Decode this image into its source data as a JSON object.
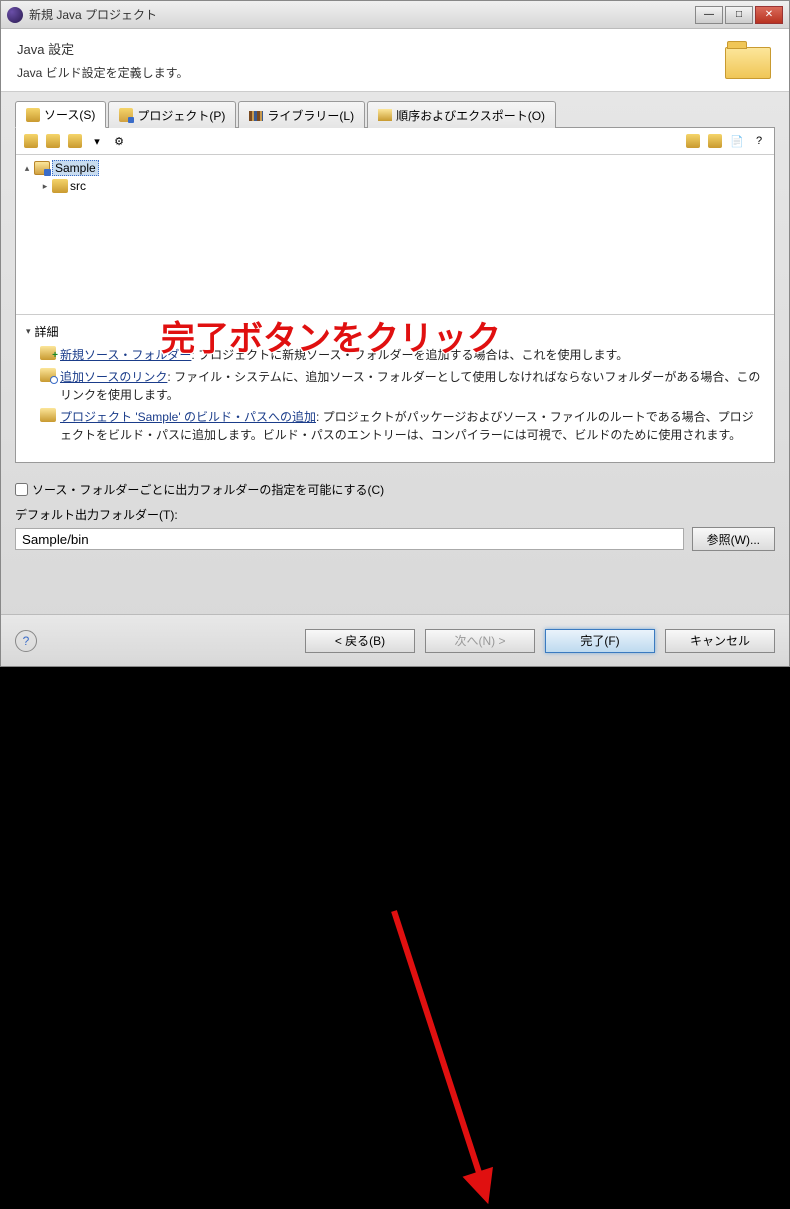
{
  "window": {
    "title": "新規 Java プロジェクト"
  },
  "header": {
    "title": "Java 設定",
    "desc": "Java ビルド設定を定義します。"
  },
  "tabs": [
    {
      "label": "ソース(S)"
    },
    {
      "label": "プロジェクト(P)"
    },
    {
      "label": "ライブラリー(L)"
    },
    {
      "label": "順序およびエクスポート(O)"
    }
  ],
  "tree": {
    "project": "Sample",
    "src": "src"
  },
  "details": {
    "title": "詳細",
    "links": [
      {
        "label": "新規ソース・フォルダー",
        "desc": ": プロジェクトに新規ソース・フォルダーを追加する場合は、これを使用します。"
      },
      {
        "label": "追加ソースのリンク",
        "desc": ": ファイル・システムに、追加ソース・フォルダーとして使用しなければならないフォルダーがある場合、このリンクを使用します。"
      },
      {
        "label": "プロジェクト 'Sample' のビルド・パスへの追加",
        "desc": ": プロジェクトがパッケージおよびソース・ファイルのルートである場合、プロジェクトをビルド・パスに追加します。ビルド・パスのエントリーは、コンパイラーには可視で、ビルドのために使用されます。"
      }
    ]
  },
  "lower": {
    "checkbox": "ソース・フォルダーごとに出力フォルダーの指定を可能にする(C)",
    "outLabel": "デフォルト出力フォルダー(T):",
    "outValue": "Sample/bin",
    "browse": "参照(W)..."
  },
  "footer": {
    "back": "< 戻る(B)",
    "next": "次へ(N) >",
    "finish": "完了(F)",
    "cancel": "キャンセル"
  },
  "annotation": "完了ボタンをクリック"
}
